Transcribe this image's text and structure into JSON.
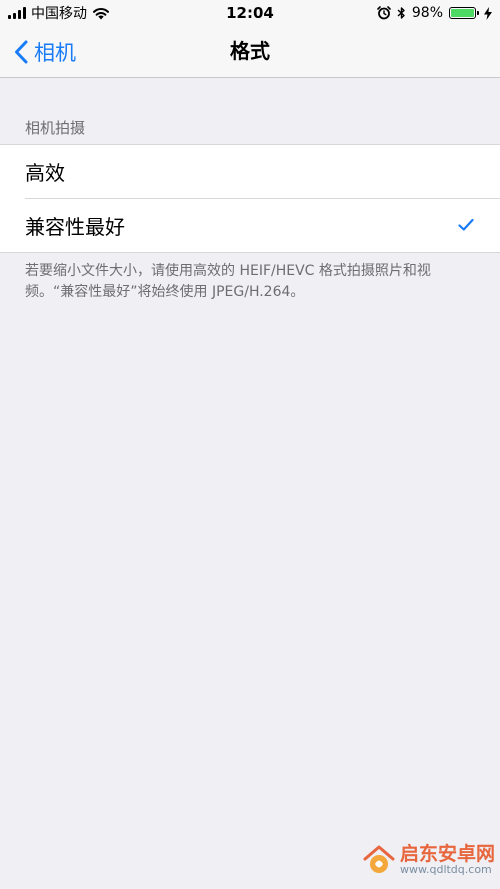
{
  "status_bar": {
    "carrier": "中国移动",
    "time": "12:04",
    "battery_percent": "98%",
    "battery_level": 0.98,
    "icons": [
      "signal-icon",
      "wifi-icon",
      "alarm-icon",
      "bluetooth-icon",
      "battery-icon",
      "charging-icon"
    ]
  },
  "nav": {
    "back_label": "相机",
    "title": "格式"
  },
  "section": {
    "header": "相机拍摄",
    "options": [
      {
        "label": "高效",
        "selected": false
      },
      {
        "label": "兼容性最好",
        "selected": true
      }
    ],
    "footer": "若要缩小文件大小，请使用高效的 HEIF/HEVC 格式拍摄照片和视频。“兼容性最好”将始终使用 JPEG/H.264。"
  },
  "watermark": {
    "name": "启东安卓网",
    "url": "www.qdltdq.com"
  },
  "colors": {
    "accent": "#1a7cf5",
    "background": "#efeff4",
    "secondary_text": "#6d6d72",
    "battery": "#4cd964"
  }
}
